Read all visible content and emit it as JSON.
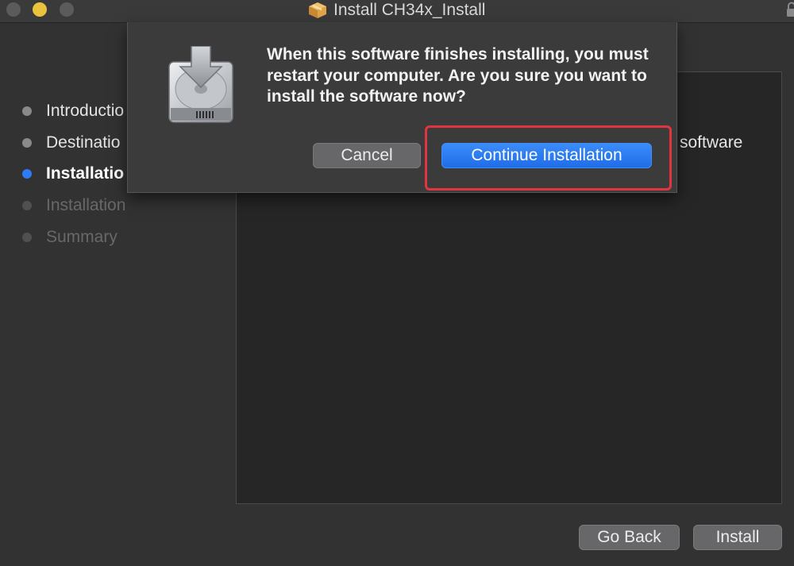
{
  "window": {
    "title": "Install CH34x_Install"
  },
  "sidebar": {
    "steps": [
      {
        "label": "Introductio",
        "state": "done"
      },
      {
        "label": "Destinatio",
        "state": "done"
      },
      {
        "label": "Installatio",
        "state": "active"
      },
      {
        "label": "Installation",
        "state": "pending"
      },
      {
        "label": "Summary",
        "state": "pending"
      }
    ]
  },
  "content": {
    "partial_text": "software"
  },
  "dialog": {
    "message": "When this software finishes installing, you must restart your computer. Are you sure you want to install the software now?",
    "cancel_label": "Cancel",
    "continue_label": "Continue Installation"
  },
  "footer": {
    "go_back_label": "Go Back",
    "install_label": "Install"
  },
  "colors": {
    "accent": "#2f7bf5",
    "highlight": "#e2343f",
    "minimize_light": "#e9c33d"
  },
  "icons": {
    "title": "package-icon",
    "dialog": "installer-disk-icon",
    "lock": "lock-icon"
  }
}
